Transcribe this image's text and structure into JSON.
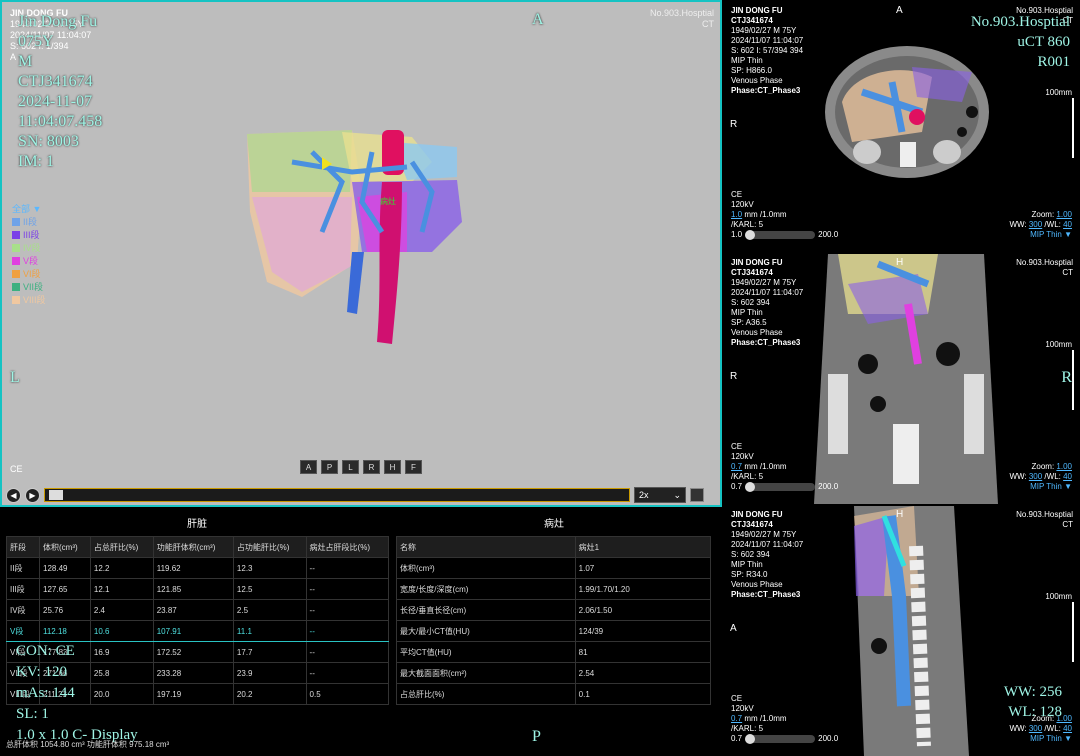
{
  "main": {
    "patient_name": "Jin Dong Fu",
    "age": "075Y",
    "sex": "M",
    "id": "CTJ341674",
    "date": "2024-11-07",
    "time": "11:04:07.458",
    "sn": "SN: 8003",
    "im": "IM: 1",
    "small_name": "JIN DONG FU",
    "small_dob": "1949/02/27 M 75Y",
    "small_datetime": "2024/11/07 11:04:07",
    "small_si": "S: 602 I: 1/394",
    "small_a": "A",
    "hospital": "No.903.Hosptial",
    "modality": "CT",
    "orient_top": "A",
    "orient_left": "L",
    "orient_bottom": "P",
    "ce": "CE",
    "legend_title": "全部 ▼",
    "legend": [
      {
        "label": "II段",
        "color": "#6fa3e8"
      },
      {
        "label": "III段",
        "color": "#7a40e8"
      },
      {
        "label": "IV段",
        "color": "#a8e08a"
      },
      {
        "label": "V段",
        "color": "#e040e0"
      },
      {
        "label": "VI段",
        "color": "#f0a040"
      },
      {
        "label": "VII段",
        "color": "#3cb080"
      },
      {
        "label": "VIII段",
        "color": "#f0c8a0"
      }
    ],
    "lesion_label": "病灶",
    "con": "CON: CE",
    "kv": "KV: 120",
    "mas": "mAs: 144",
    "sl": "SL: 1",
    "display": "1.0 x 1.0  C- Display",
    "view_buttons": [
      "A",
      "P",
      "L",
      "R",
      "H",
      "F"
    ],
    "speed": "2x"
  },
  "views": [
    {
      "name": "JIN DONG FU",
      "id": "CTJ341674",
      "dob": "1949/02/27 M 75Y",
      "datetime": "2024/11/07 11:04:07",
      "si": "S: 602 I: 57/394 394",
      "mip": "MIP Thin",
      "sp": "SP: H866.0",
      "phase": "Venous Phase",
      "phase2": "Phase:CT_Phase3",
      "hospital": "No.903.Hosptial",
      "modality": "CT",
      "top": "A",
      "left": "R",
      "right": "",
      "ce": "CE",
      "kv": "120kV",
      "mm": "1.0",
      "mm_suffix": " mm /1.0mm",
      "karl": "/KARL: 5",
      "slider_min": "1.0",
      "slider_max": "200.0",
      "zoom": "1.00",
      "ww": "300",
      "wl": "40",
      "big1": "No.903.Hosptial",
      "big2": "uCT 860",
      "big3": "R001",
      "scale": "100mm",
      "mip_mode": "MIP Thin ▼"
    },
    {
      "name": "JIN DONG FU",
      "id": "CTJ341674",
      "dob": "1949/02/27 M 75Y",
      "datetime": "2024/11/07 11:04:07",
      "si": "S: 602  394",
      "mip": "MIP Thin",
      "sp": "SP: A36.5",
      "phase": "Venous Phase",
      "phase2": "Phase:CT_Phase3",
      "hospital": "No.903.Hosptial",
      "modality": "CT",
      "top": "H",
      "left": "R",
      "right": "R",
      "ce": "CE",
      "kv": "120kV",
      "mm": "0.7",
      "mm_suffix": " mm /1.0mm",
      "karl": "/KARL: 5",
      "slider_min": "0.7",
      "slider_max": "200.0",
      "zoom": "1.00",
      "ww": "300",
      "wl": "40",
      "scale": "100mm",
      "mip_mode": "MIP Thin ▼"
    },
    {
      "name": "JIN DONG FU",
      "id": "CTJ341674",
      "dob": "1949/02/27 M 75Y",
      "datetime": "2024/11/07 11:04:07",
      "si": "S: 602  394",
      "mip": "MIP Thin",
      "sp": "SP: R34.0",
      "phase": "Venous Phase",
      "phase2": "Phase:CT_Phase3",
      "hospital": "No.903.Hosptial",
      "modality": "CT",
      "top": "H",
      "left": "A",
      "right": "",
      "ce": "CE",
      "kv": "120kV",
      "mm": "0.7",
      "mm_suffix": " mm /1.0mm",
      "karl": "/KARL: 5",
      "slider_min": "0.7",
      "slider_max": "200.0",
      "zoom": "1.00",
      "ww": "300",
      "wl": "40",
      "big_ww": "WW: 256",
      "big_wl": "WL: 128",
      "scale": "100mm",
      "mip_mode": "MIP Thin ▼"
    }
  ],
  "liver": {
    "title": "肝脏",
    "headers": [
      "肝段",
      "体积(cm³)",
      "占总肝比(%)",
      "功能肝体积(cm³)",
      "占功能肝比(%)",
      "病灶占肝段比(%)"
    ],
    "rows": [
      [
        "II段",
        "128.49",
        "12.2",
        "119.62",
        "12.3",
        "--"
      ],
      [
        "III段",
        "127.65",
        "12.1",
        "121.85",
        "12.5",
        "--"
      ],
      [
        "IV段",
        "25.76",
        "2.4",
        "23.87",
        "2.5",
        "--"
      ],
      [
        "V段",
        "112.18",
        "10.6",
        "107.91",
        "11.1",
        "--"
      ],
      [
        "VI段",
        "177.83",
        "16.9",
        "172.52",
        "17.7",
        "--"
      ],
      [
        "VII段",
        "271.66",
        "25.8",
        "233.28",
        "23.9",
        "--"
      ],
      [
        "VIII段",
        "211.23",
        "20.0",
        "197.19",
        "20.2",
        "0.5"
      ]
    ],
    "footer": "总肝体积 1054.80 cm³    功能肝体积 975.18 cm³"
  },
  "lesion": {
    "title": "病灶",
    "rows": [
      [
        "名称",
        "病灶1"
      ],
      [
        "体积(cm³)",
        "1.07"
      ],
      [
        "宽度/长度/深度(cm)",
        "1.99/1.70/1.20"
      ],
      [
        "长径/垂直长径(cm)",
        "2.06/1.50"
      ],
      [
        "最大/最小CT值(HU)",
        "124/39"
      ],
      [
        "平均CT值(HU)",
        "81"
      ],
      [
        "最大截面面积(cm²)",
        "2.54"
      ],
      [
        "占总肝比(%)",
        "0.1"
      ]
    ]
  }
}
